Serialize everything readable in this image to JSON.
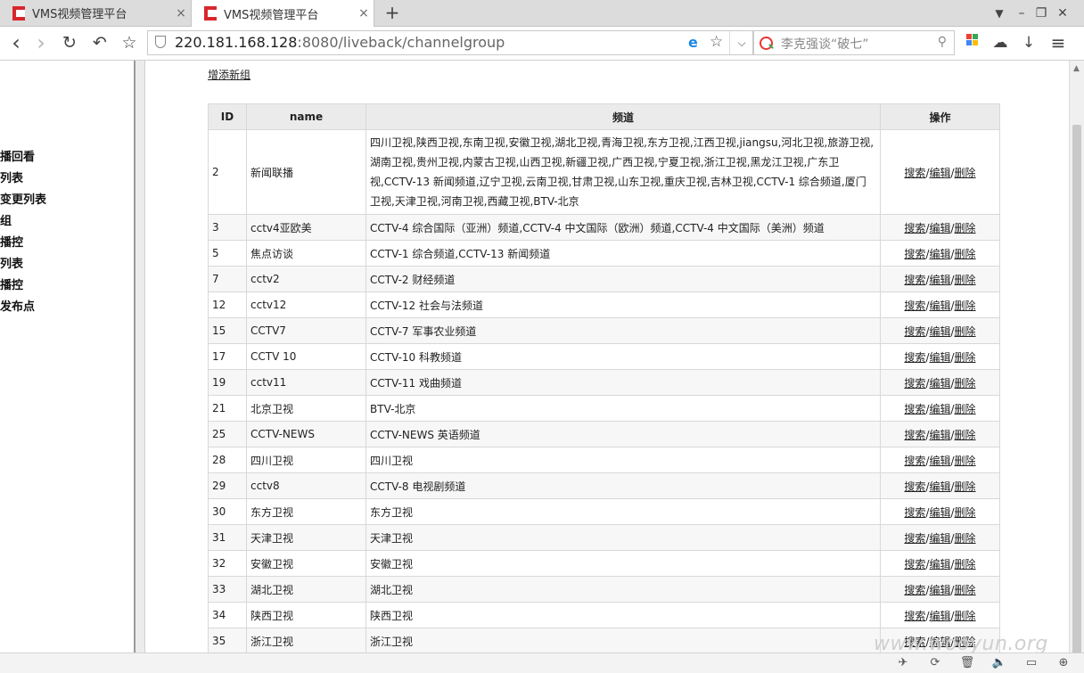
{
  "browser": {
    "tabs": [
      {
        "title": "VMS视频管理平台",
        "active": false
      },
      {
        "title": "VMS视频管理平台",
        "active": true
      }
    ],
    "url_host": "220.181.168.128",
    "url_rest": ":8080/liveback/channelgroup",
    "search_placeholder": "李克强谈“破七”",
    "icons": {
      "new_tab": "+",
      "close_tab": "×",
      "back": "‹",
      "forward": "›",
      "reload": "↻",
      "undo": "↶",
      "bookmark": "☆",
      "ie_mode": "e",
      "star": "☆",
      "dropdown": "⌵",
      "search_glass": "⚲",
      "cloud": "☁",
      "download": "↓",
      "menu": "≡",
      "shirt": "👕",
      "minimize": "–",
      "restore": "❐",
      "close_window": "✕"
    }
  },
  "sidebar": {
    "items": [
      "播回看",
      "列表",
      "变更列表",
      "组",
      "播控",
      "列表",
      "播控",
      "发布点"
    ]
  },
  "page": {
    "add_link": "增添新组",
    "headers": {
      "id": "ID",
      "name": "name",
      "channels": "频道",
      "ops": "操作"
    },
    "ops_labels": {
      "search": "搜索",
      "edit": "编辑",
      "delete": "删除",
      "sep": "/"
    },
    "rows": [
      {
        "id": "2",
        "name": "新闻联播",
        "channels": "四川卫视,陕西卫视,东南卫视,安徽卫视,湖北卫视,青海卫视,东方卫视,江西卫视,jiangsu,河北卫视,旅游卫视,湖南卫视,贵州卫视,内蒙古卫视,山西卫视,新疆卫视,广西卫视,宁夏卫视,浙江卫视,黑龙江卫视,广东卫视,CCTV-13 新闻频道,辽宁卫视,云南卫视,甘肃卫视,山东卫视,重庆卫视,吉林卫视,CCTV-1 综合频道,厦门卫视,天津卫视,河南卫视,西藏卫视,BTV-北京"
      },
      {
        "id": "3",
        "name": "cctv4亚欧美",
        "channels": "CCTV-4 综合国际（亚洲）频道,CCTV-4 中文国际（欧洲）频道,CCTV-4 中文国际（美洲）频道"
      },
      {
        "id": "5",
        "name": "焦点访谈",
        "channels": "CCTV-1 综合频道,CCTV-13 新闻频道"
      },
      {
        "id": "7",
        "name": "cctv2",
        "channels": "CCTV-2 财经频道"
      },
      {
        "id": "12",
        "name": "cctv12",
        "channels": "CCTV-12 社会与法频道"
      },
      {
        "id": "15",
        "name": "CCTV7",
        "channels": "CCTV-7 军事农业频道"
      },
      {
        "id": "17",
        "name": "CCTV 10",
        "channels": "CCTV-10 科教频道"
      },
      {
        "id": "19",
        "name": "cctv11",
        "channels": "CCTV-11 戏曲频道"
      },
      {
        "id": "21",
        "name": "北京卫视",
        "channels": "BTV-北京"
      },
      {
        "id": "25",
        "name": "CCTV-NEWS",
        "channels": "CCTV-NEWS 英语频道"
      },
      {
        "id": "28",
        "name": "四川卫视",
        "channels": "四川卫视"
      },
      {
        "id": "29",
        "name": "cctv8",
        "channels": "CCTV-8 电视剧频道"
      },
      {
        "id": "30",
        "name": "东方卫视",
        "channels": "东方卫视"
      },
      {
        "id": "31",
        "name": "天津卫视",
        "channels": "天津卫视"
      },
      {
        "id": "32",
        "name": "安徽卫视",
        "channels": "安徽卫视"
      },
      {
        "id": "33",
        "name": "湖北卫视",
        "channels": "湖北卫视"
      },
      {
        "id": "34",
        "name": "陕西卫视",
        "channels": "陕西卫视"
      },
      {
        "id": "35",
        "name": "浙江卫视",
        "channels": "浙江卫视"
      }
    ]
  },
  "watermark": "www.wooyun.org",
  "status_icons": [
    "pin-icon",
    "refresh-icon",
    "trash-icon",
    "speaker-icon",
    "window-icon",
    "zoom-icon"
  ]
}
